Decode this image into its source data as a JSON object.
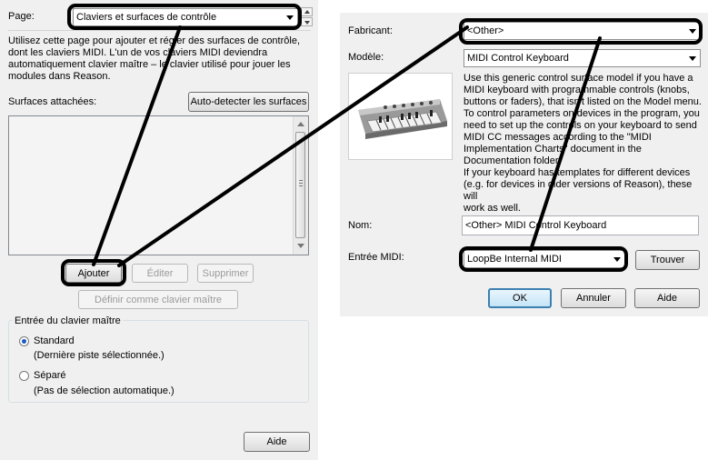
{
  "left": {
    "page_label": "Page:",
    "page_value": "Claviers et surfaces de contrôle",
    "intro_lines": [
      "Utilisez cette page pour ajouter et régler des surfaces de contrôle,",
      "dont les claviers MIDI. L'un de vos claviers MIDI deviendra",
      "automatiquement clavier maître – le clavier utilisé pour jouer les",
      "modules dans Reason."
    ],
    "attached_label": "Surfaces attachées:",
    "autodetect_label": "Auto-detecter les surfaces",
    "add_label": "Ajouter",
    "edit_label": "Éditer",
    "delete_label": "Supprimer",
    "set_master_label": "Définir comme clavier maître",
    "master_group_label": "Entrée du clavier maître",
    "radio_standard": "Standard",
    "radio_standard_sub": "(Dernière piste sélectionnée.)",
    "radio_separate": "Séparé",
    "radio_separate_sub": "(Pas de sélection automatique.)",
    "help_label": "Aide"
  },
  "right": {
    "manufacturer_label": "Fabricant:",
    "manufacturer_value": "<Other>",
    "model_label": "Modèle:",
    "model_value": "MIDI Control Keyboard",
    "description_lines": [
      "Use this generic control surface model if you have a",
      "MIDI keyboard with programmable controls (knobs,",
      "buttons or faders), that isn't listed on the Model menu.",
      "To control parameters on devices in the program, you",
      "need to set up the controls on your keyboard to send",
      "MIDI CC messages according to the \"MIDI",
      "Implementation Charts\" document in the",
      "Documentation folder.",
      "If your keyboard has templates for different devices",
      "(e.g. for devices in older versions of Reason), these will",
      "work as well."
    ],
    "name_label": "Nom:",
    "name_value": "<Other> MIDI Control Keyboard",
    "midi_input_label": "Entrée MIDI:",
    "midi_input_value": "LoopBe Internal MIDI",
    "find_label": "Trouver",
    "ok_label": "OK",
    "cancel_label": "Annuler",
    "help_label": "Aide"
  },
  "icons": [
    "keyboard-image",
    "scrollbar-up-icon",
    "scrollbar-down-icon",
    "spin-up-icon",
    "spin-down-icon"
  ],
  "colors": {
    "panel": "#f0f0f0",
    "highlight": "#000000",
    "radio_selected": "#1d5bbf"
  }
}
